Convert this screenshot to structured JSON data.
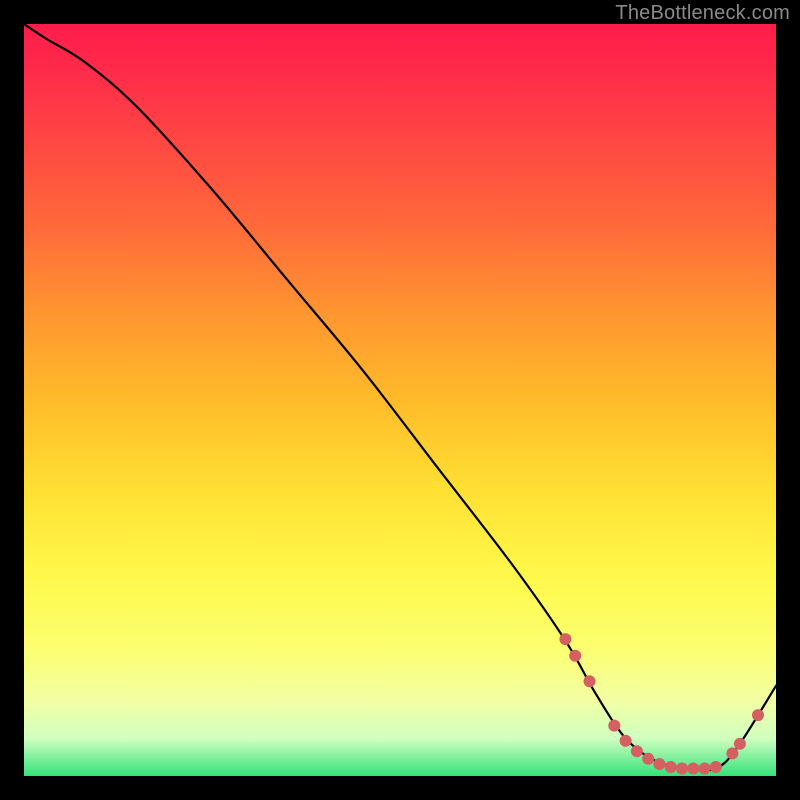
{
  "attribution": "TheBottleneck.com",
  "chart_data": {
    "type": "line",
    "title": "",
    "xlabel": "",
    "ylabel": "",
    "xlim": [
      0,
      100
    ],
    "ylim": [
      0,
      100
    ],
    "grid": false,
    "series": [
      {
        "name": "curve",
        "x": [
          0,
          3,
          8,
          15,
          25,
          35,
          45,
          55,
          65,
          72,
          76,
          80,
          84,
          88,
          92,
          95,
          100
        ],
        "y": [
          100,
          98,
          95,
          89,
          78,
          66,
          54,
          41,
          28,
          18,
          11,
          5,
          2,
          1,
          1,
          4,
          12
        ]
      }
    ],
    "markers": {
      "name": "highlight-points",
      "color": "#d46062",
      "x": [
        72.0,
        73.3,
        75.2,
        78.5,
        80.0,
        81.5,
        83.0,
        84.5,
        86.0,
        87.5,
        89.0,
        90.5,
        92.0,
        94.2,
        95.2,
        97.6
      ],
      "y": [
        18.2,
        16.0,
        12.6,
        6.7,
        4.7,
        3.3,
        2.3,
        1.6,
        1.2,
        1.0,
        1.0,
        1.0,
        1.2,
        3.0,
        4.3,
        8.1
      ]
    }
  }
}
